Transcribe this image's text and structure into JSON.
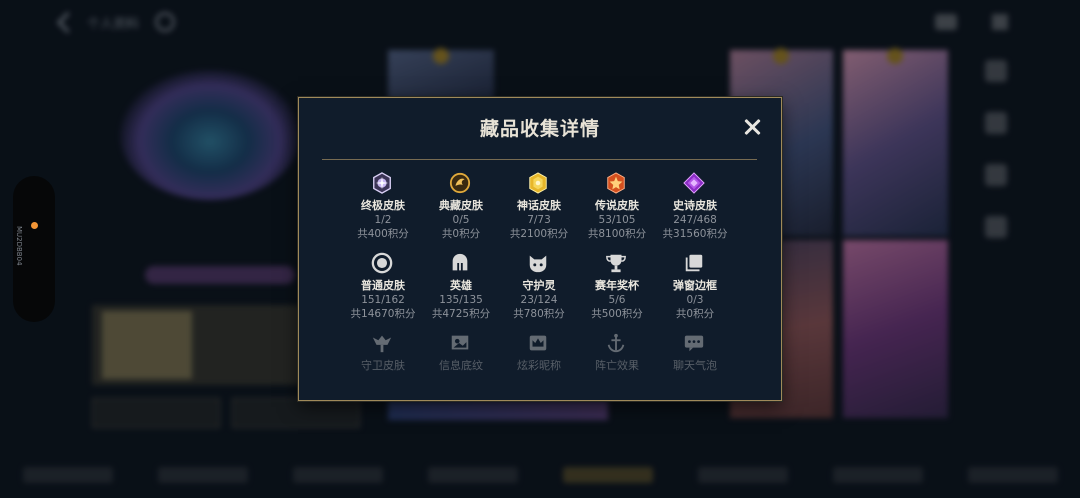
{
  "topbar": {
    "title": "个人资料"
  },
  "modal": {
    "title": "藏品收集详情",
    "items": [
      {
        "name": "终极皮肤",
        "count": "1/2",
        "points": "共400积分",
        "icon": "ultimate-gem-icon",
        "color": "#b9a8e6"
      },
      {
        "name": "典藏皮肤",
        "count": "0/5",
        "points": "共0积分",
        "icon": "dragon-medal-icon",
        "color": "#d6a13a"
      },
      {
        "name": "神话皮肤",
        "count": "7/73",
        "points": "共2100积分",
        "icon": "mythic-gem-icon",
        "color": "#e7b629"
      },
      {
        "name": "传说皮肤",
        "count": "53/105",
        "points": "共8100积分",
        "icon": "legendary-gem-icon",
        "color": "#e05a2a"
      },
      {
        "name": "史诗皮肤",
        "count": "247/468",
        "points": "共31560积分",
        "icon": "epic-gem-icon",
        "color": "#a33ad6"
      },
      {
        "name": "普通皮肤",
        "count": "151/162",
        "points": "共14670积分",
        "icon": "normal-ring-icon",
        "color": "#cfcfcf"
      },
      {
        "name": "英雄",
        "count": "135/135",
        "points": "共4725积分",
        "icon": "helmet-icon",
        "color": "#cfcfcf"
      },
      {
        "name": "守护灵",
        "count": "23/124",
        "points": "共780积分",
        "icon": "cat-face-icon",
        "color": "#cfcfcf"
      },
      {
        "name": "赛年奖杯",
        "count": "5/6",
        "points": "共500积分",
        "icon": "trophy-icon",
        "color": "#cfcfcf"
      },
      {
        "name": "弹窗边框",
        "count": "0/3",
        "points": "共0积分",
        "icon": "frame-icon",
        "color": "#cfcfcf"
      }
    ],
    "faded_items": [
      {
        "name": "守卫皮肤",
        "icon": "ward-icon"
      },
      {
        "name": "信息底纹",
        "icon": "banner-icon"
      },
      {
        "name": "炫彩昵称",
        "icon": "crown-icon"
      },
      {
        "name": "阵亡效果",
        "icon": "anchor-icon"
      },
      {
        "name": "聊天气泡",
        "icon": "chat-bubble-icon"
      }
    ]
  },
  "sidebar": {
    "vertical_text": "MU2DBB04"
  }
}
